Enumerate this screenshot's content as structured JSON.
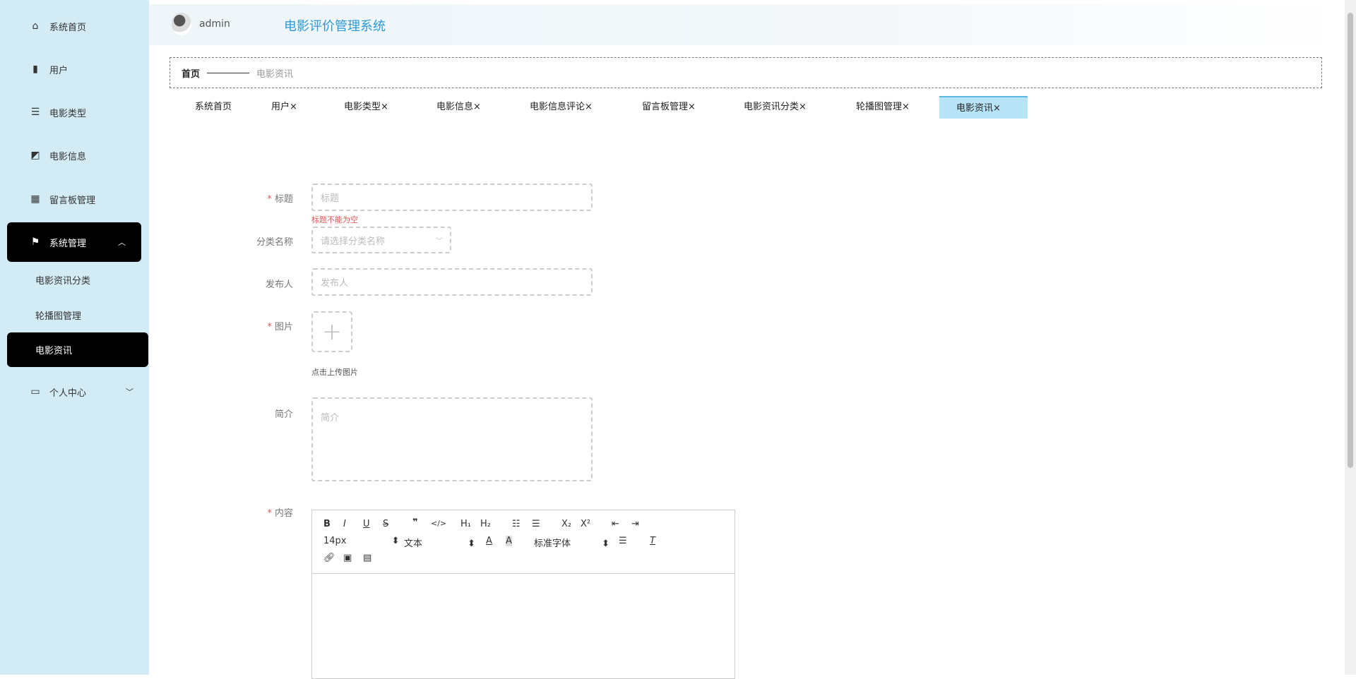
{
  "sidebar": {
    "items": [
      {
        "label": "系统首页",
        "icon": "home-icon"
      },
      {
        "label": "用户",
        "icon": "book-icon"
      },
      {
        "label": "电影类型",
        "icon": "sliders-icon"
      },
      {
        "label": "电影信息",
        "icon": "chart-icon"
      },
      {
        "label": "留言板管理",
        "icon": "grid-icon"
      },
      {
        "label": "系统管理",
        "icon": "flag-icon"
      },
      {
        "label": "个人中心",
        "icon": "card-icon"
      }
    ],
    "submenu": [
      "电影资讯分类",
      "轮播图管理",
      "电影资讯"
    ]
  },
  "header": {
    "user": "admin",
    "title": "电影评价管理系统"
  },
  "breadcrumb": {
    "home": "首页",
    "current": "电影资讯"
  },
  "tabs": [
    "系统首页",
    "用户×",
    "电影类型×",
    "电影信息×",
    "电影信息评论×",
    "留言板管理×",
    "电影资讯分类×",
    "轮播图管理×",
    "电影资讯×"
  ],
  "form": {
    "title": {
      "label": "标题",
      "placeholder": "标题",
      "error": "标题不能为空"
    },
    "category": {
      "label": "分类名称",
      "placeholder": "请选择分类名称"
    },
    "publisher": {
      "label": "发布人",
      "placeholder": "发布人"
    },
    "image": {
      "label": "图片",
      "hint": "点击上传图片"
    },
    "intro": {
      "label": "简介",
      "placeholder": "简介"
    },
    "content": {
      "label": "内容",
      "font_size": "14px",
      "text_type": "文本",
      "font_family": "标准字体"
    }
  }
}
